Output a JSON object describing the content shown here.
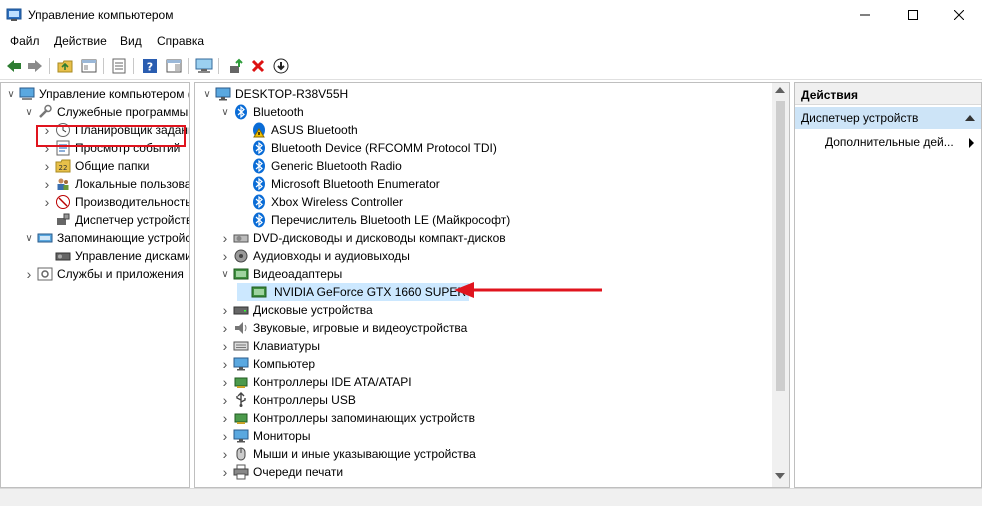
{
  "window": {
    "title": "Управление компьютером"
  },
  "menu": [
    "Файл",
    "Действие",
    "Вид",
    "Справка"
  ],
  "left_tree": [
    {
      "label": "Управление компьютером (л",
      "level": 0,
      "expander": "open",
      "icon": "computer-management-icon"
    },
    {
      "label": "Служебные программы",
      "level": 1,
      "expander": "open",
      "icon": "tools-icon"
    },
    {
      "label": "Планировщик заданий",
      "level": 2,
      "expander": "closed",
      "icon": "clock-icon"
    },
    {
      "label": "Просмотр событий",
      "level": 2,
      "expander": "closed",
      "icon": "event-viewer-icon"
    },
    {
      "label": "Общие папки",
      "level": 2,
      "expander": "closed",
      "icon": "shared-folder-icon"
    },
    {
      "label": "Локальные пользовате",
      "level": 2,
      "expander": "closed",
      "icon": "users-icon"
    },
    {
      "label": "Производительность",
      "level": 2,
      "expander": "closed",
      "icon": "performance-icon"
    },
    {
      "label": "Диспетчер устройств",
      "level": 2,
      "expander": "none",
      "icon": "device-manager-icon"
    },
    {
      "label": "Запоминающие устройст",
      "level": 1,
      "expander": "open",
      "icon": "storage-icon"
    },
    {
      "label": "Управление дисками",
      "level": 2,
      "expander": "none",
      "icon": "disk-management-icon"
    },
    {
      "label": "Службы и приложения",
      "level": 1,
      "expander": "closed",
      "icon": "services-icon"
    }
  ],
  "device_tree": [
    {
      "label": "DESKTOP-R38V55H",
      "level": 0,
      "expander": "open",
      "icon": "computer-icon"
    },
    {
      "label": "Bluetooth",
      "level": 1,
      "expander": "open",
      "icon": "bluetooth-icon"
    },
    {
      "label": "ASUS Bluetooth",
      "level": 2,
      "expander": "none",
      "icon": "bluetooth-warning-icon"
    },
    {
      "label": "Bluetooth Device (RFCOMM Protocol TDI)",
      "level": 2,
      "expander": "none",
      "icon": "bluetooth-icon"
    },
    {
      "label": "Generic Bluetooth Radio",
      "level": 2,
      "expander": "none",
      "icon": "bluetooth-icon"
    },
    {
      "label": "Microsoft Bluetooth Enumerator",
      "level": 2,
      "expander": "none",
      "icon": "bluetooth-icon"
    },
    {
      "label": "Xbox Wireless Controller",
      "level": 2,
      "expander": "none",
      "icon": "bluetooth-icon"
    },
    {
      "label": "Перечислитель Bluetooth LE (Майкрософт)",
      "level": 2,
      "expander": "none",
      "icon": "bluetooth-icon"
    },
    {
      "label": "DVD-дисководы и дисководы компакт-дисков",
      "level": 1,
      "expander": "closed",
      "icon": "dvd-drive-icon"
    },
    {
      "label": "Аудиовходы и аудиовыходы",
      "level": 1,
      "expander": "closed",
      "icon": "audio-icon"
    },
    {
      "label": "Видеоадаптеры",
      "level": 1,
      "expander": "open",
      "icon": "display-adapter-icon"
    },
    {
      "label": "NVIDIA GeForce GTX 1660 SUPER",
      "level": 2,
      "expander": "none",
      "icon": "display-adapter-icon",
      "selected": true
    },
    {
      "label": "Дисковые устройства",
      "level": 1,
      "expander": "closed",
      "icon": "disk-drive-icon"
    },
    {
      "label": "Звуковые, игровые и видеоустройства",
      "level": 1,
      "expander": "closed",
      "icon": "speaker-icon"
    },
    {
      "label": "Клавиатуры",
      "level": 1,
      "expander": "closed",
      "icon": "keyboard-icon"
    },
    {
      "label": "Компьютер",
      "level": 1,
      "expander": "closed",
      "icon": "monitor-icon"
    },
    {
      "label": "Контроллеры IDE ATA/ATAPI",
      "level": 1,
      "expander": "closed",
      "icon": "ide-controller-icon"
    },
    {
      "label": "Контроллеры USB",
      "level": 1,
      "expander": "closed",
      "icon": "usb-icon"
    },
    {
      "label": "Контроллеры запоминающих устройств",
      "level": 1,
      "expander": "closed",
      "icon": "storage-controller-icon"
    },
    {
      "label": "Мониторы",
      "level": 1,
      "expander": "closed",
      "icon": "monitor-icon"
    },
    {
      "label": "Мыши и иные указывающие устройства",
      "level": 1,
      "expander": "closed",
      "icon": "mouse-icon"
    },
    {
      "label": "Очереди печати",
      "level": 1,
      "expander": "closed",
      "icon": "printer-icon"
    }
  ],
  "actions": {
    "header": "Действия",
    "section": "Диспетчер устройств",
    "item": "Дополнительные дей..."
  },
  "colors": {
    "annotation_red": "#e0141e",
    "selection_blue": "#cce8ff",
    "bluetooth_blue": "#0a6cd6",
    "actions_section_bg": "#cde4f7"
  }
}
